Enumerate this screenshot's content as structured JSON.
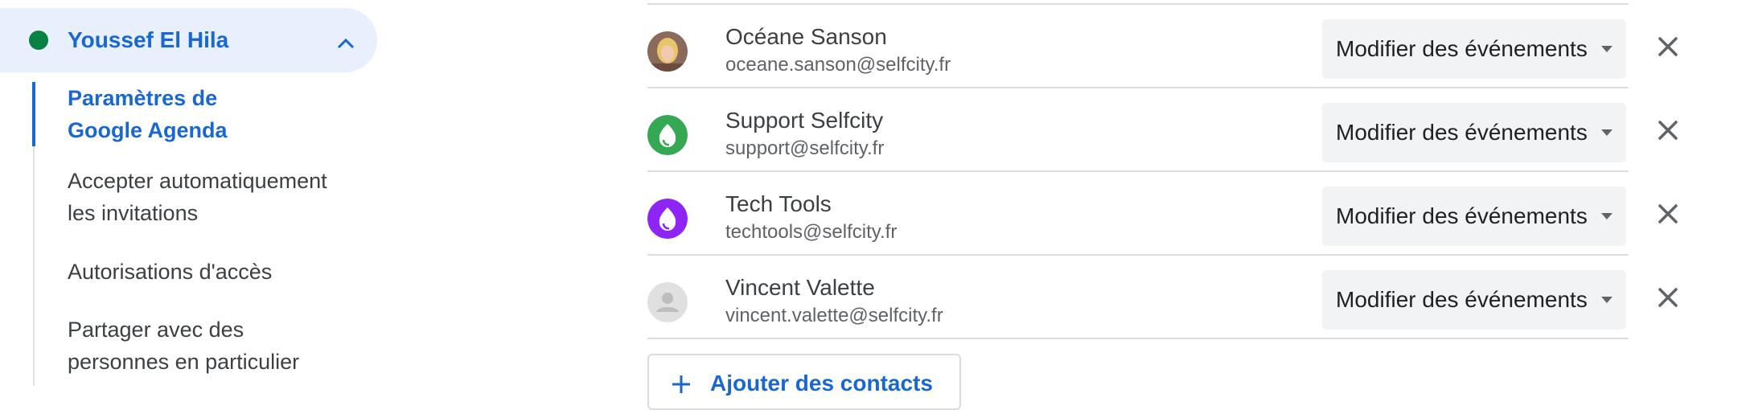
{
  "sidebar": {
    "account": {
      "name": "Youssef El Hila",
      "color": "#0b8043"
    },
    "items": [
      {
        "label_lines": [
          "Paramètres de",
          "Google Agenda"
        ],
        "active": true
      },
      {
        "label_lines": [
          "Accepter automatiquement",
          "les invitations"
        ],
        "active": false
      },
      {
        "label_lines": [
          "Autorisations d'accès"
        ],
        "active": false
      },
      {
        "label_lines": [
          "Partager avec des",
          "personnes en particulier"
        ],
        "active": false
      }
    ]
  },
  "shares": [
    {
      "name": "Océane Sanson",
      "email": "oceane.sanson@selfcity.fr",
      "avatar": "photo",
      "permission": "Modifier des événements"
    },
    {
      "name": "Support Selfcity",
      "email": "support@selfcity.fr",
      "avatar": "green-drop",
      "permission": "Modifier des événements"
    },
    {
      "name": "Tech Tools",
      "email": "techtools@selfcity.fr",
      "avatar": "purple-drop",
      "permission": "Modifier des événements"
    },
    {
      "name": "Vincent Valette",
      "email": "vincent.valette@selfcity.fr",
      "avatar": "default-person",
      "permission": "Modifier des événements"
    }
  ],
  "add_contacts": {
    "label": "Ajouter des contacts"
  },
  "colors": {
    "accent": "#1967d2",
    "green": "#34a853",
    "purple": "#8e24f5"
  }
}
